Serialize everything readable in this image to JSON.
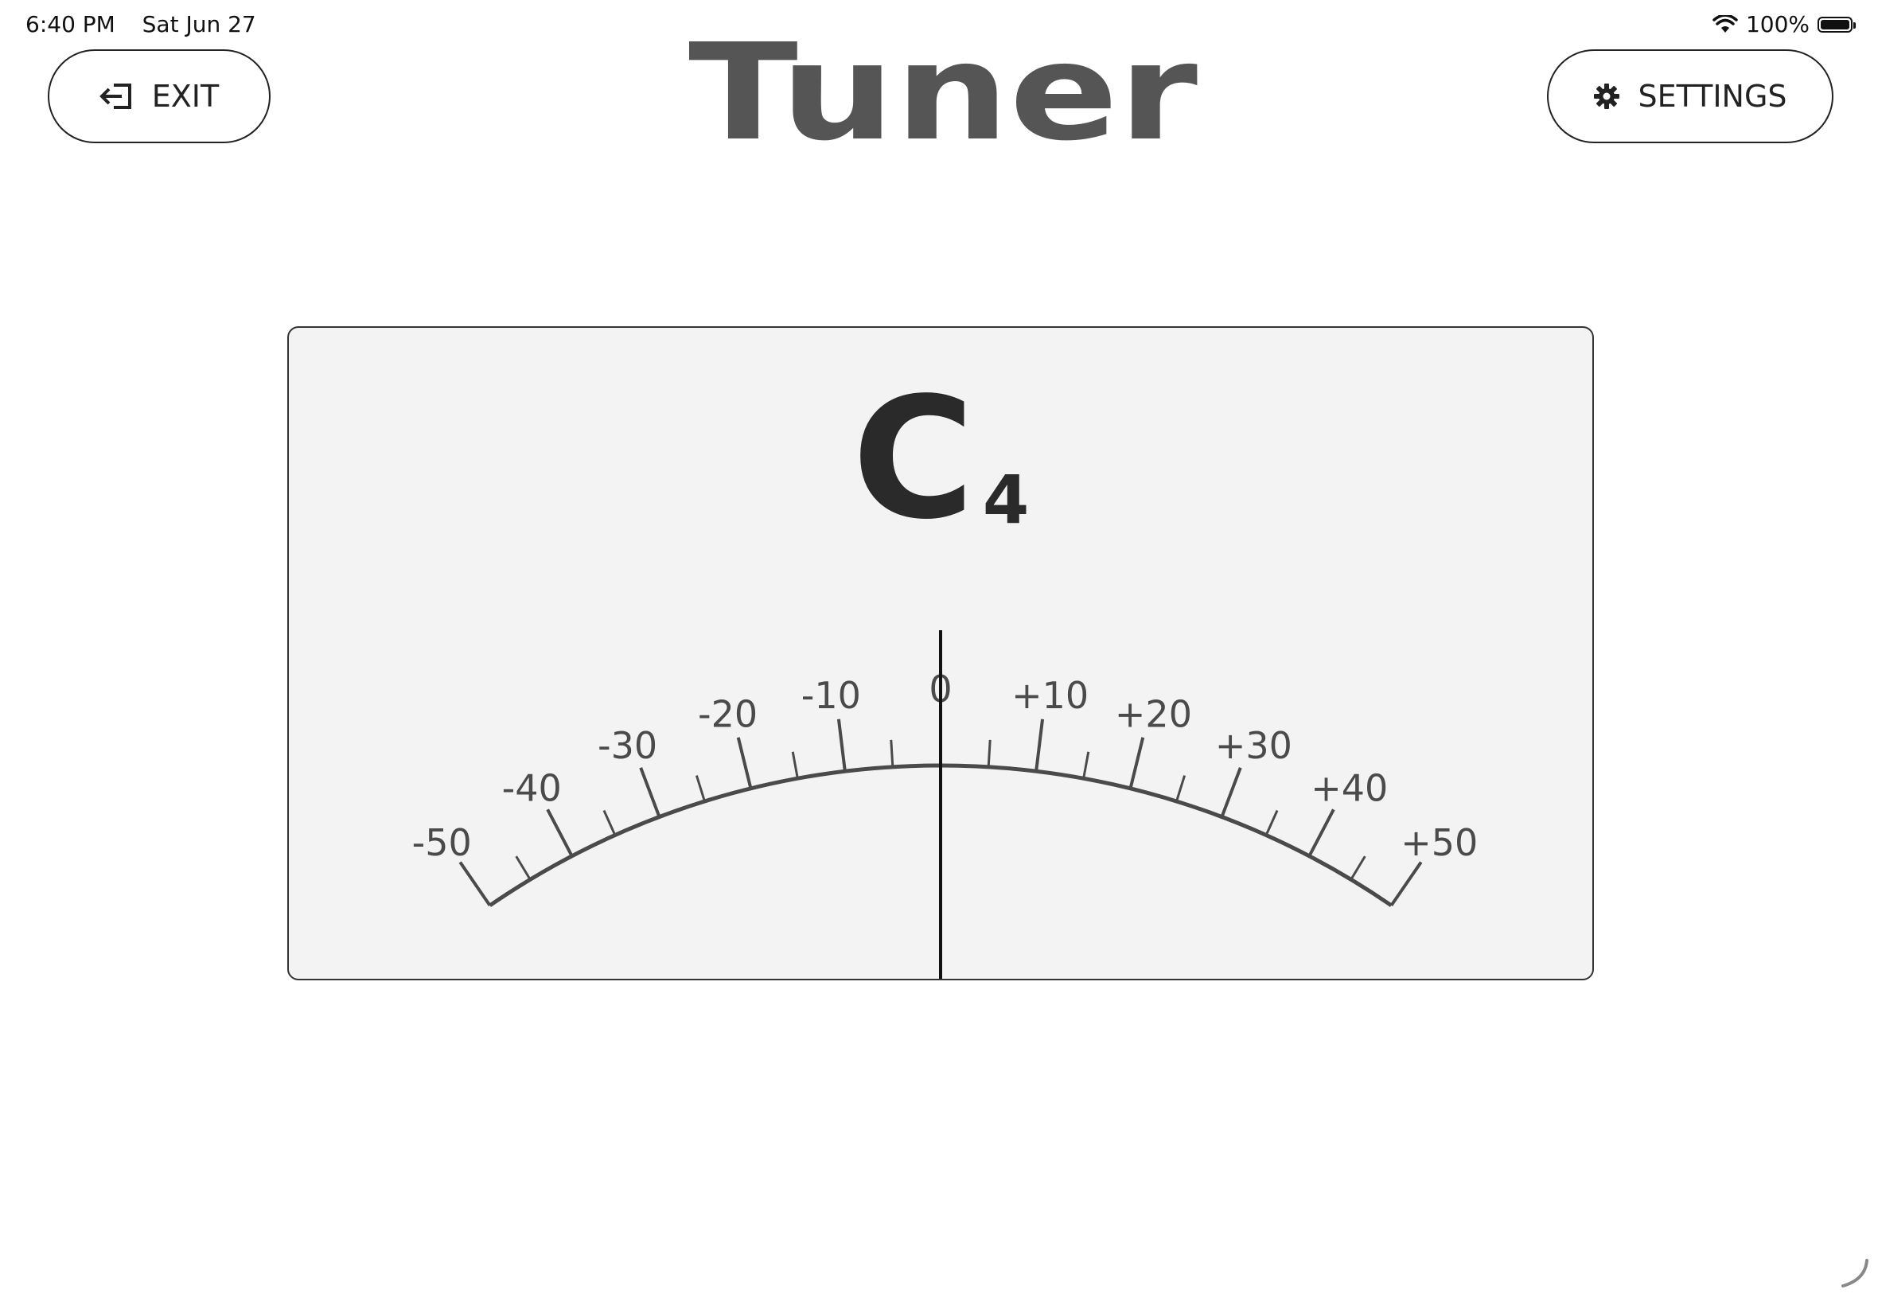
{
  "status": {
    "time": "6:40 PM",
    "date": "Sat Jun 27",
    "battery": "100%"
  },
  "app": {
    "title": "Tuner"
  },
  "toolbar": {
    "exit_label": "EXIT",
    "settings_label": "SETTINGS"
  },
  "tuner": {
    "note": "C",
    "octave": "4",
    "cents_offset": 0,
    "scale_labels": [
      "-50",
      "-40",
      "-30",
      "-20",
      "-10",
      "0",
      "+10",
      "+20",
      "+30",
      "+40",
      "+50"
    ]
  },
  "colors": {
    "panel_bg": "#f3f3f3",
    "ink": "#4a4a4a",
    "title": "#555555"
  },
  "icons": {
    "exit": "exit-icon",
    "settings": "gear-icon",
    "wifi": "wifi-icon",
    "battery": "battery-icon"
  }
}
